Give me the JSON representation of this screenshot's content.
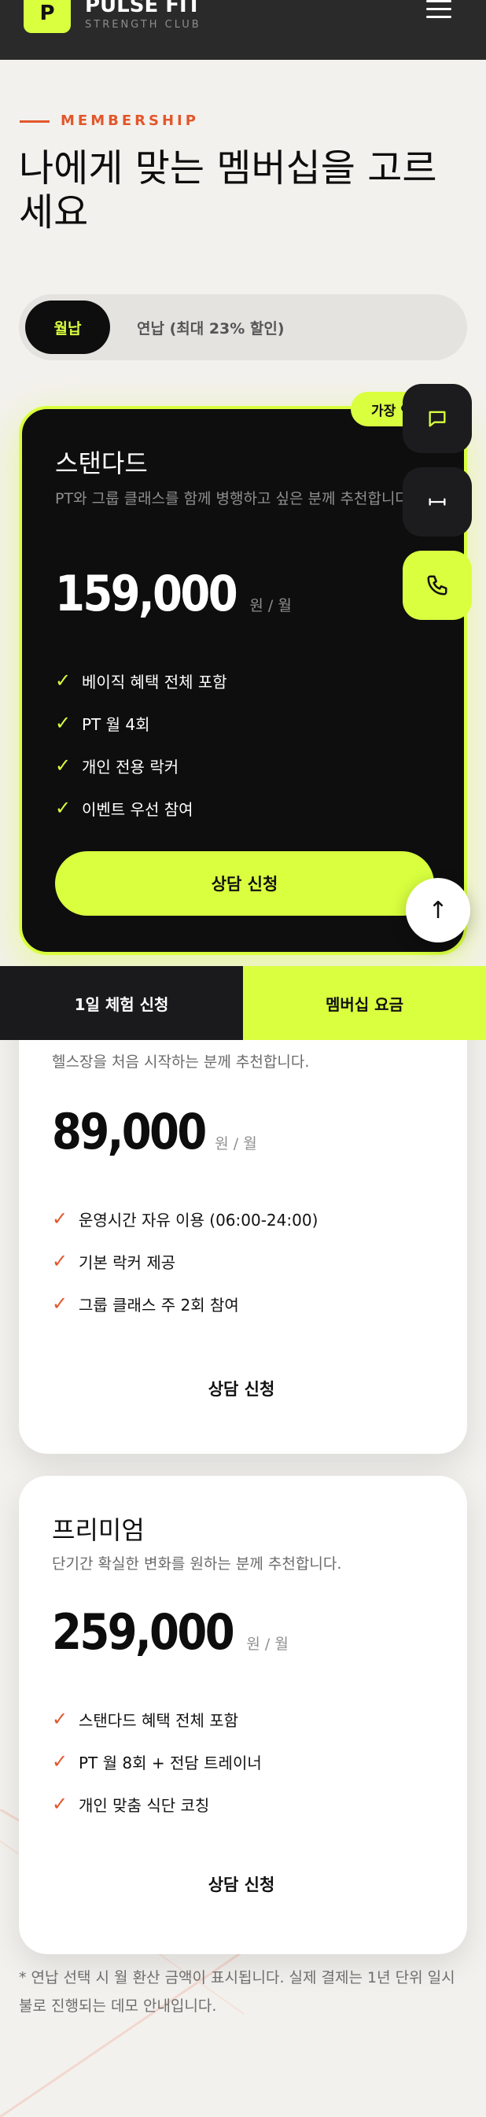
{
  "header": {
    "logo_letter": "P",
    "brand_name": "PULSE FIT",
    "brand_sub": "STRENGTH CLUB"
  },
  "intro": {
    "eyebrow": "MEMBERSHIP",
    "title": "나에게 맞는 멤버십을 고르세요"
  },
  "billing_toggle": {
    "monthly_label": "월납",
    "yearly_label": "연납 (최대 23% 할인)",
    "selected": "월납"
  },
  "plans": {
    "standard": {
      "badge": "가장 인기",
      "name": "스탠다드",
      "description": "PT와 그룹 클래스를 함께 병행하고 싶은 분께 추천합니다.",
      "price": "159,000",
      "unit": "원 / 월",
      "features": [
        "베이직 혜택 전체 포함",
        "PT 월 4회",
        "개인 전용 락커",
        "이벤트 우선 참여"
      ],
      "cta": "상담 신청"
    },
    "basic": {
      "description": "헬스장을 처음 시작하는 분께 추천합니다.",
      "price": "89,000",
      "unit": "원 / 월",
      "features": [
        "운영시간 자유 이용 (06:00-24:00)",
        "기본 락커 제공",
        "그룹 클래스 주 2회 참여"
      ],
      "cta": "상담 신청"
    },
    "premium": {
      "name": "프리미엄",
      "description": "단기간 확실한 변화를 원하는 분께 추천합니다.",
      "price": "259,000",
      "unit": "원 / 월",
      "features": [
        "스탠다드 혜택 전체 포함",
        "PT 월 8회 + 전담 트레이너",
        "개인 맞춤 식단 코칭"
      ],
      "cta": "상담 신청"
    }
  },
  "footnote": "* 연납 선택 시 월 환산 금액이 표시됩니다. 실제 결제는 1년 단위 일시불로 진행되는 데모 안내입니다.",
  "bottom_bar": {
    "trial_label": "1일 체험 신청",
    "pricing_label": "멤버십 요금"
  },
  "colors": {
    "accent_lime": "#d9ff3f",
    "accent_orange": "#e2572b",
    "dark": "#0e0e0e"
  },
  "icons": {
    "chat": "chat-icon",
    "swap": "resize-horizontal-icon",
    "phone": "phone-icon",
    "scroll_top": "arrow-up-icon"
  }
}
